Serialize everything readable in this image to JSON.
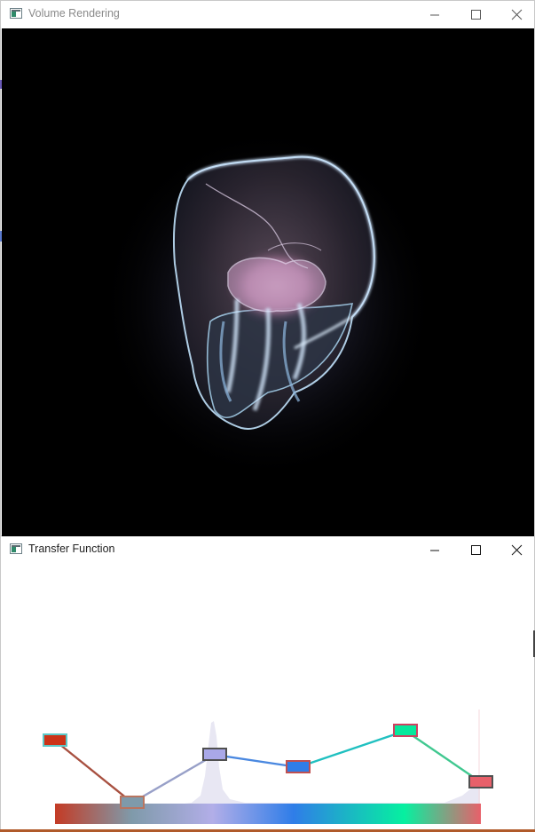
{
  "volume_window": {
    "title": "Volume Rendering",
    "minimize_icon": "minimize-icon",
    "maximize_icon": "maximize-icon",
    "close_icon": "close-icon"
  },
  "transfer_window": {
    "title": "Transfer Function",
    "minimize_icon": "minimize-icon",
    "maximize_icon": "maximize-icon",
    "close_icon": "close-icon"
  },
  "transfer_function": {
    "gradient_stops": [
      "#c43b25",
      "#7f9aaa",
      "#b2aee8",
      "#2f7de8",
      "#06f0a0",
      "#e8606a"
    ],
    "control_points": [
      {
        "color": "#cc3318",
        "border": "#5ec8c8"
      },
      {
        "color": "#7f9aaa",
        "border": "#b87560"
      },
      {
        "color": "#a9a8e8",
        "border": "#505050"
      },
      {
        "color": "#2f7de8",
        "border": "#c05050"
      },
      {
        "color": "#06e89c",
        "border": "#d04060"
      },
      {
        "color": "#e8606a",
        "border": "#505050"
      }
    ]
  }
}
